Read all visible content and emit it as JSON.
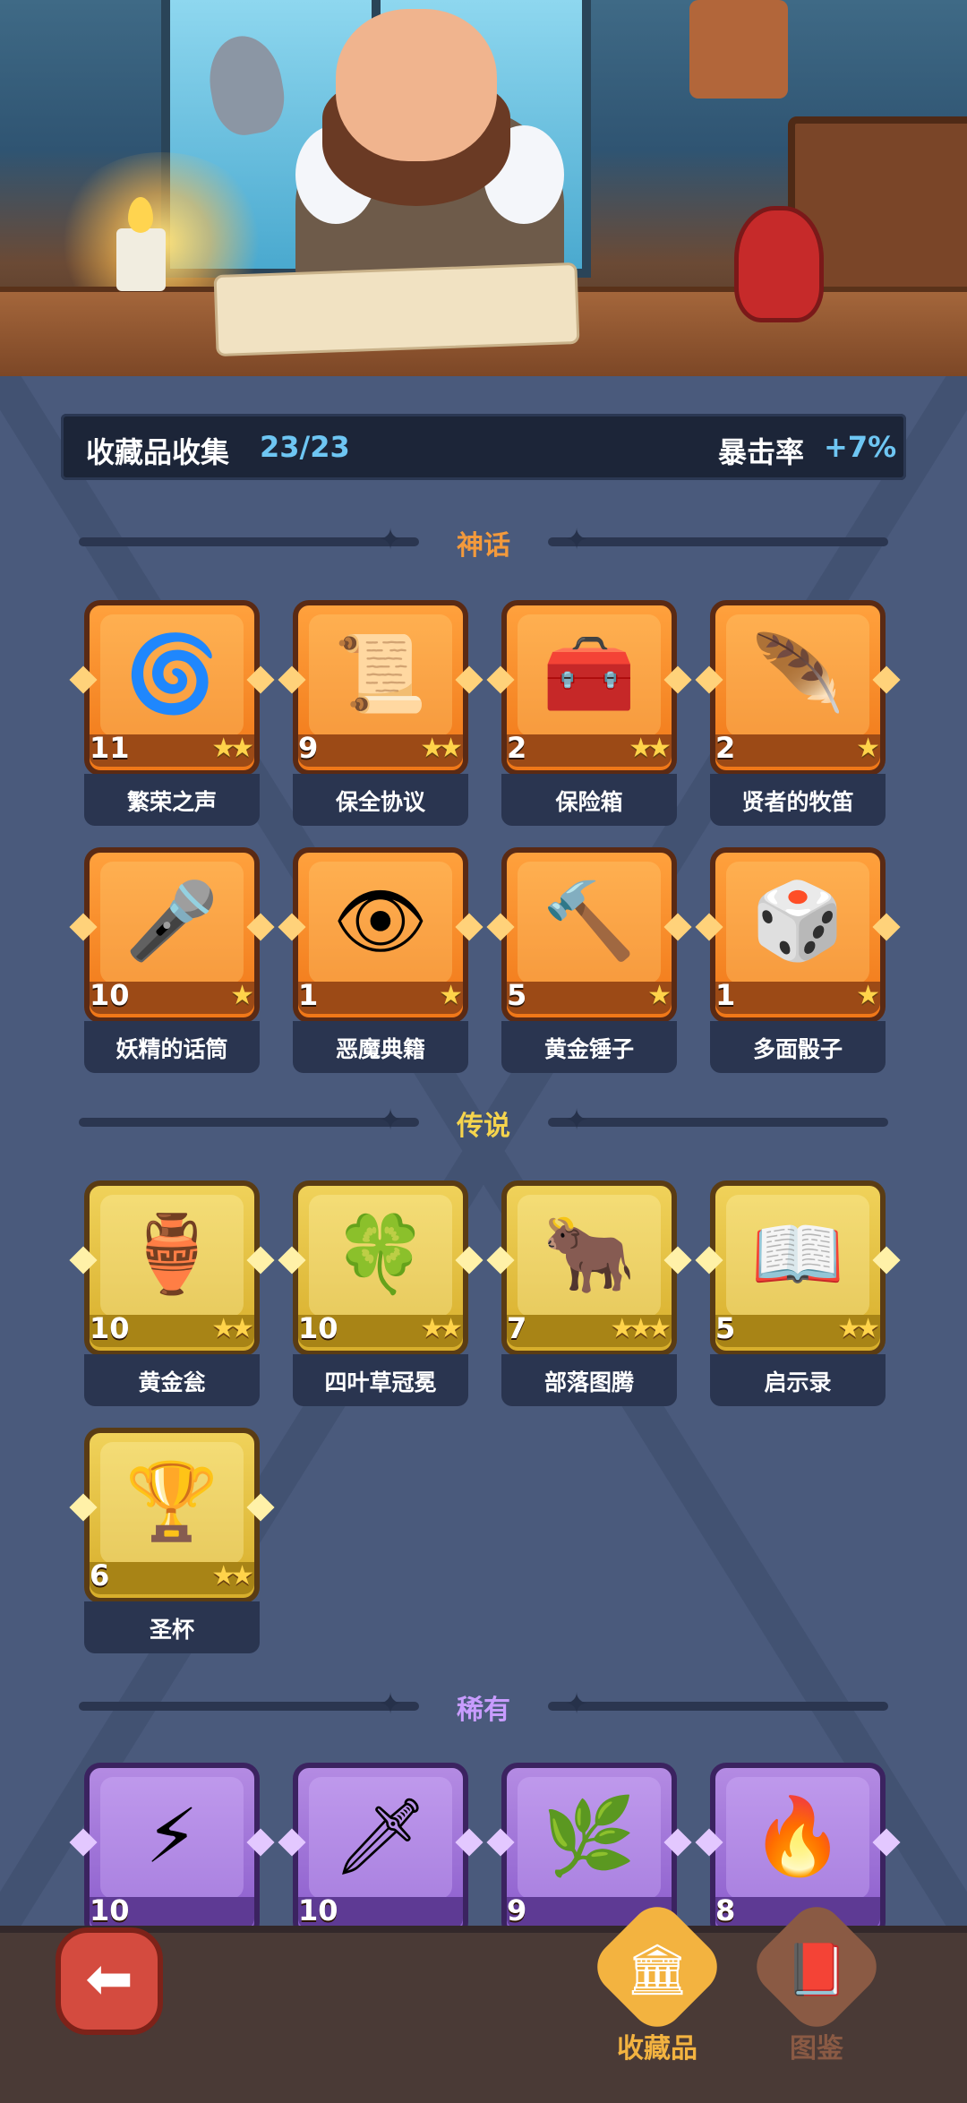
{
  "header": {
    "collection_label": "收藏品收集",
    "collection_count": "23/23",
    "crit_label": "暴击率",
    "crit_value": "+7%"
  },
  "sections": {
    "mythic": {
      "title": "神话",
      "color": "#f39a3c"
    },
    "legendary": {
      "title": "传说",
      "color": "#f5d44d"
    },
    "rare": {
      "title": "稀有",
      "color": "#c89cff"
    }
  },
  "mythic_items": [
    {
      "name": "繁荣之声",
      "count": "11",
      "stars": "★★",
      "icon": "blue-spirit-icon",
      "glyph": "🌀"
    },
    {
      "name": "保全协议",
      "count": "9",
      "stars": "★★",
      "icon": "contract-scroll-icon",
      "glyph": "📜"
    },
    {
      "name": "保险箱",
      "count": "2",
      "stars": "★★",
      "icon": "gold-chest-icon",
      "glyph": "🧰"
    },
    {
      "name": "贤者的牧笛",
      "count": "2",
      "stars": "★",
      "icon": "sage-flute-icon",
      "glyph": "🪶"
    },
    {
      "name": "妖精的话筒",
      "count": "10",
      "stars": "★",
      "icon": "fairy-microphone-icon",
      "glyph": "🎤"
    },
    {
      "name": "恶魔典籍",
      "count": "1",
      "stars": "★",
      "icon": "demon-book-icon",
      "glyph": "👁"
    },
    {
      "name": "黄金锤子",
      "count": "5",
      "stars": "★",
      "icon": "golden-hammer-icon",
      "glyph": "🔨"
    },
    {
      "name": "多面骰子",
      "count": "1",
      "stars": "★",
      "icon": "polyhedral-dice-icon",
      "glyph": "🎲"
    }
  ],
  "legendary_items": [
    {
      "name": "黄金瓮",
      "count": "10",
      "stars": "★★",
      "icon": "golden-urn-icon",
      "glyph": "🏺"
    },
    {
      "name": "四叶草冠冕",
      "count": "10",
      "stars": "★★",
      "icon": "clover-crown-icon",
      "glyph": "🍀"
    },
    {
      "name": "部落图腾",
      "count": "7",
      "stars": "★★★",
      "icon": "tribal-totem-icon",
      "glyph": "🐂"
    },
    {
      "name": "启示录",
      "count": "5",
      "stars": "★★",
      "icon": "revelation-book-icon",
      "glyph": "📖"
    },
    {
      "name": "圣杯",
      "count": "6",
      "stars": "★★",
      "icon": "holy-grail-icon",
      "glyph": "🏆"
    }
  ],
  "rare_items": [
    {
      "count": "10",
      "icon": "lightning-card-icon",
      "glyph": "⚡"
    },
    {
      "count": "10",
      "icon": "frost-dagger-icon",
      "glyph": "🗡"
    },
    {
      "count": "9",
      "icon": "thorn-vine-icon",
      "glyph": "🌿"
    },
    {
      "count": "8",
      "icon": "fire-scepter-icon",
      "glyph": "🔥"
    }
  ],
  "nav": {
    "back_icon": "back-arrow-icon",
    "back_glyph": "⬅",
    "collectibles_label": "收藏品",
    "collectibles_glyph": "🏛",
    "codex_label": "图鉴",
    "codex_glyph": "📕",
    "active_color": "#f3b340",
    "inactive_color": "#8a5a44"
  }
}
